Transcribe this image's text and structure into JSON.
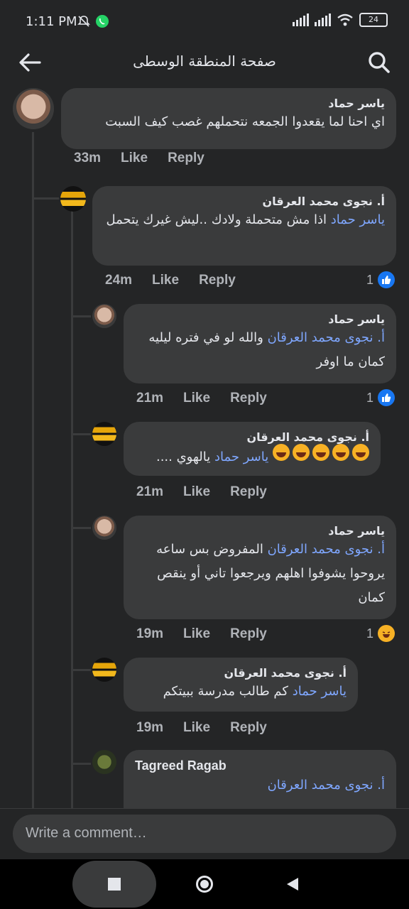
{
  "status": {
    "time": "1:11 PM",
    "battery": "24"
  },
  "header": {
    "title": "صفحة المنطقة الوسطى"
  },
  "comments": [
    {
      "author": "ياسر حماد",
      "mention": "",
      "text": "اي احنا لما يقعدوا الجمعه نتحملهم غصب كيف السبت",
      "time": "33m",
      "like": "Like",
      "reply": "Reply",
      "reactions": ""
    },
    {
      "author": "أ. نجوى محمد العرقان",
      "mention": "ياسر حماد",
      "text": "اذا مش متحملة ولادك ..ليش غيرك يتحمل",
      "time": "24m",
      "like": "Like",
      "reply": "Reply",
      "reactions": "1"
    },
    {
      "author": "ياسر حماد",
      "mention": "أ. نجوى محمد العرقان",
      "text": "والله لو في فتره ليليه كمان ما اوفر",
      "time": "21m",
      "like": "Like",
      "reply": "Reply",
      "reactions": "1"
    },
    {
      "author": "أ. نجوى محمد العرقان",
      "mention": "ياسر حماد",
      "text": "يالهوي ....",
      "time": "21m",
      "like": "Like",
      "reply": "Reply",
      "reactions": ""
    },
    {
      "author": "ياسر حماد",
      "mention": "أ. نجوى محمد العرقان",
      "text": "المفروض بس ساعه يروحوا يشوفوا اهلهم ويرجعوا تاني أو ينقص كمان",
      "time": "19m",
      "like": "Like",
      "reply": "Reply",
      "reactions": "1"
    },
    {
      "author": "أ. نجوى محمد العرقان",
      "mention": "ياسر حماد",
      "text": "كم طالب مدرسة ببيتكم",
      "time": "19m",
      "like": "Like",
      "reply": "Reply",
      "reactions": ""
    },
    {
      "author": "Tagreed Ragab",
      "mention": "أ. نجوى محمد العرقان",
      "text": "",
      "time": "",
      "like": "",
      "reply": "",
      "reactions": ""
    }
  ],
  "composer": {
    "placeholder": "Write a comment…"
  }
}
